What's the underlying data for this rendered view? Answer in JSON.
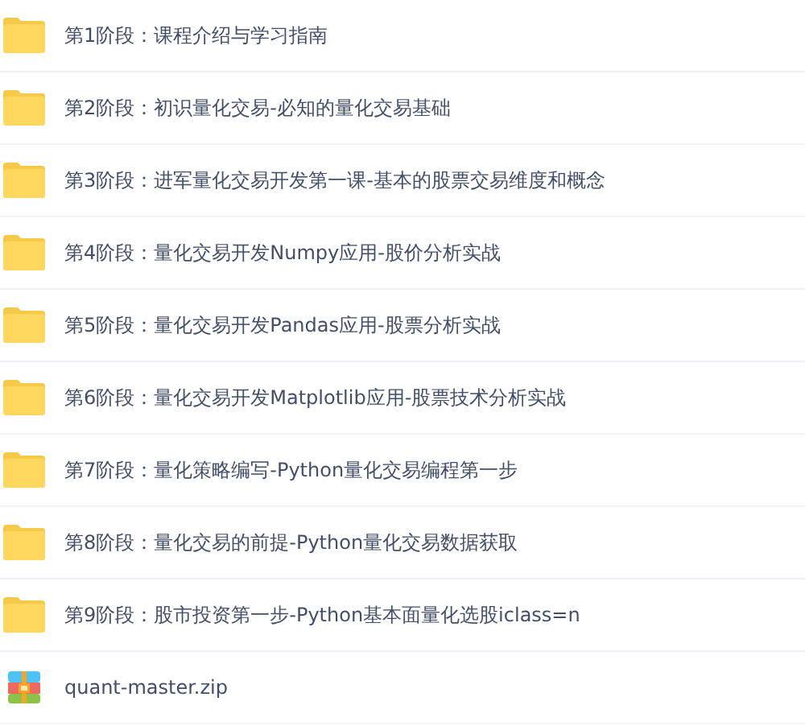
{
  "files": [
    {
      "kind": "folder",
      "name": "第1阶段：课程介绍与学习指南"
    },
    {
      "kind": "folder",
      "name": "第2阶段：初识量化交易-必知的量化交易基础"
    },
    {
      "kind": "folder",
      "name": "第3阶段：进军量化交易开发第一课-基本的股票交易维度和概念"
    },
    {
      "kind": "folder",
      "name": "第4阶段：量化交易开发Numpy应用-股价分析实战"
    },
    {
      "kind": "folder",
      "name": "第5阶段：量化交易开发Pandas应用-股票分析实战"
    },
    {
      "kind": "folder",
      "name": "第6阶段：量化交易开发Matplotlib应用-股票技术分析实战"
    },
    {
      "kind": "folder",
      "name": "第7阶段：量化策略编写-Python量化交易编程第一步"
    },
    {
      "kind": "folder",
      "name": "第8阶段：量化交易的前提-Python量化交易数据获取"
    },
    {
      "kind": "folder",
      "name": "第9阶段：股市投资第一步-Python基本面量化选股iclass=n"
    },
    {
      "kind": "zip",
      "name": "quant-master.zip"
    }
  ]
}
